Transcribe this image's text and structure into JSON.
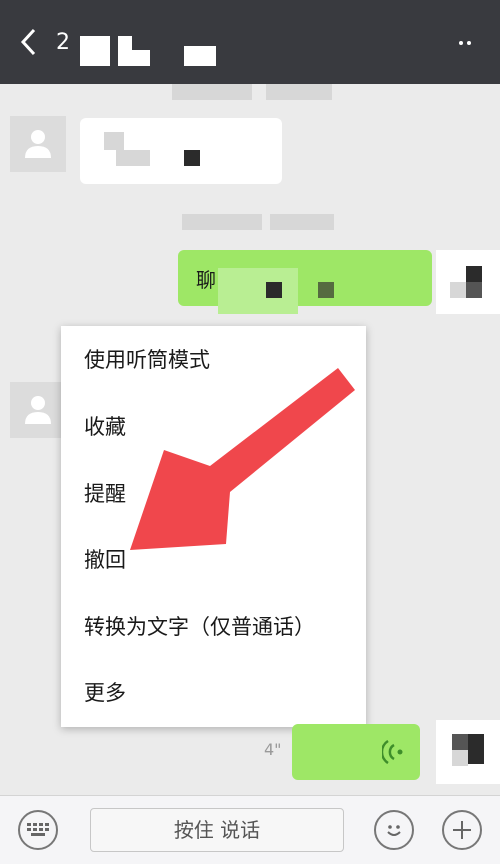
{
  "header": {
    "title_fragment": "2",
    "back_icon": "chevron-left-icon",
    "more_icon": "more-dots-icon"
  },
  "messages": {
    "outgoing_text_fragment": "聊",
    "voice_duration": "4\""
  },
  "context_menu": {
    "items": [
      "使用听筒模式",
      "收藏",
      "提醒",
      "撤回",
      "转换为文字（仅普通话）",
      "更多"
    ]
  },
  "input_bar": {
    "hold_to_talk_label": "按住 说话",
    "keyboard_icon": "keyboard-icon",
    "emoji_icon": "emoji-icon",
    "plus_icon": "plus-icon"
  },
  "colors": {
    "topbar": "#393a3f",
    "chat_background": "#ebebeb",
    "outgoing_bubble": "#9ee766",
    "annotation_arrow": "#f0474c"
  }
}
